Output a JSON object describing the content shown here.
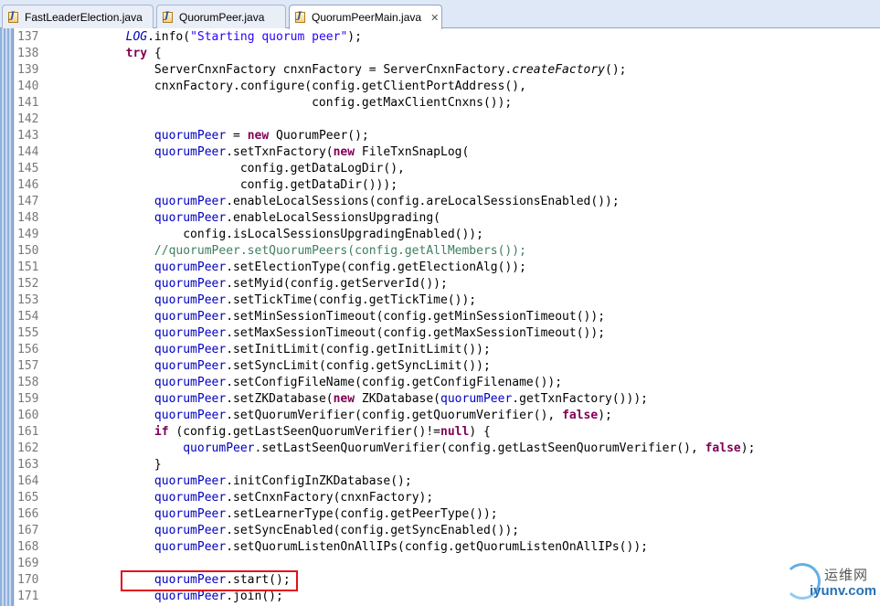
{
  "tabs": [
    {
      "label": "FastLeaderElection.java",
      "active": false
    },
    {
      "label": "QuorumPeer.java",
      "active": false
    },
    {
      "label": "QuorumPeerMain.java",
      "active": true,
      "close": "✕"
    }
  ],
  "colors": {
    "keyword": "#7f0055",
    "field": "#0000c0",
    "string": "#2a00ff",
    "comment": "#3f7f5f",
    "highlight": "#e0121b"
  },
  "lines": [
    {
      "n": "137",
      "tokens": [
        [
          "        ",
          ""
        ],
        [
          "LOG",
          "fld it"
        ],
        [
          ".info(",
          ""
        ],
        [
          "\"Starting quorum peer\"",
          "str"
        ],
        [
          ");",
          ""
        ]
      ]
    },
    {
      "n": "138",
      "tokens": [
        [
          "        ",
          ""
        ],
        [
          "try",
          "kw"
        ],
        [
          " {",
          ""
        ]
      ]
    },
    {
      "n": "139",
      "tokens": [
        [
          "            ServerCnxnFactory cnxnFactory = ServerCnxnFactory.",
          ""
        ],
        [
          "createFactory",
          "it"
        ],
        [
          "();",
          ""
        ]
      ]
    },
    {
      "n": "140",
      "tokens": [
        [
          "            cnxnFactory.configure(config.getClientPortAddress(),",
          ""
        ]
      ]
    },
    {
      "n": "141",
      "tokens": [
        [
          "                                  config.getMaxClientCnxns());",
          ""
        ]
      ]
    },
    {
      "n": "142",
      "tokens": []
    },
    {
      "n": "143",
      "tokens": [
        [
          "            ",
          ""
        ],
        [
          "quorumPeer",
          "fld"
        ],
        [
          " = ",
          ""
        ],
        [
          "new",
          "kw"
        ],
        [
          " QuorumPeer();",
          ""
        ]
      ]
    },
    {
      "n": "144",
      "tokens": [
        [
          "            ",
          ""
        ],
        [
          "quorumPeer",
          "fld"
        ],
        [
          ".setTxnFactory(",
          ""
        ],
        [
          "new",
          "kw"
        ],
        [
          " FileTxnSnapLog(",
          ""
        ]
      ]
    },
    {
      "n": "145",
      "tokens": [
        [
          "                        config.getDataLogDir(),",
          ""
        ]
      ]
    },
    {
      "n": "146",
      "tokens": [
        [
          "                        config.getDataDir()));",
          ""
        ]
      ]
    },
    {
      "n": "147",
      "tokens": [
        [
          "            ",
          ""
        ],
        [
          "quorumPeer",
          "fld"
        ],
        [
          ".enableLocalSessions(config.areLocalSessionsEnabled());",
          ""
        ]
      ]
    },
    {
      "n": "148",
      "tokens": [
        [
          "            ",
          ""
        ],
        [
          "quorumPeer",
          "fld"
        ],
        [
          ".enableLocalSessionsUpgrading(",
          ""
        ]
      ]
    },
    {
      "n": "149",
      "tokens": [
        [
          "                config.isLocalSessionsUpgradingEnabled());",
          ""
        ]
      ]
    },
    {
      "n": "150",
      "tokens": [
        [
          "            ",
          ""
        ],
        [
          "//quorumPeer.setQuorumPeers(config.getAllMembers());",
          "cm"
        ]
      ]
    },
    {
      "n": "151",
      "tokens": [
        [
          "            ",
          ""
        ],
        [
          "quorumPeer",
          "fld"
        ],
        [
          ".setElectionType(config.getElectionAlg());",
          ""
        ]
      ]
    },
    {
      "n": "152",
      "tokens": [
        [
          "            ",
          ""
        ],
        [
          "quorumPeer",
          "fld"
        ],
        [
          ".setMyid(config.getServerId());",
          ""
        ]
      ]
    },
    {
      "n": "153",
      "tokens": [
        [
          "            ",
          ""
        ],
        [
          "quorumPeer",
          "fld"
        ],
        [
          ".setTickTime(config.getTickTime());",
          ""
        ]
      ]
    },
    {
      "n": "154",
      "tokens": [
        [
          "            ",
          ""
        ],
        [
          "quorumPeer",
          "fld"
        ],
        [
          ".setMinSessionTimeout(config.getMinSessionTimeout());",
          ""
        ]
      ]
    },
    {
      "n": "155",
      "tokens": [
        [
          "            ",
          ""
        ],
        [
          "quorumPeer",
          "fld"
        ],
        [
          ".setMaxSessionTimeout(config.getMaxSessionTimeout());",
          ""
        ]
      ]
    },
    {
      "n": "156",
      "tokens": [
        [
          "            ",
          ""
        ],
        [
          "quorumPeer",
          "fld"
        ],
        [
          ".setInitLimit(config.getInitLimit());",
          ""
        ]
      ]
    },
    {
      "n": "157",
      "tokens": [
        [
          "            ",
          ""
        ],
        [
          "quorumPeer",
          "fld"
        ],
        [
          ".setSyncLimit(config.getSyncLimit());",
          ""
        ]
      ]
    },
    {
      "n": "158",
      "tokens": [
        [
          "            ",
          ""
        ],
        [
          "quorumPeer",
          "fld"
        ],
        [
          ".setConfigFileName(config.getConfigFilename());",
          ""
        ]
      ]
    },
    {
      "n": "159",
      "tokens": [
        [
          "            ",
          ""
        ],
        [
          "quorumPeer",
          "fld"
        ],
        [
          ".setZKDatabase(",
          ""
        ],
        [
          "new",
          "kw"
        ],
        [
          " ZKDatabase(",
          ""
        ],
        [
          "quorumPeer",
          "fld"
        ],
        [
          ".getTxnFactory()));",
          ""
        ]
      ]
    },
    {
      "n": "160",
      "tokens": [
        [
          "            ",
          ""
        ],
        [
          "quorumPeer",
          "fld"
        ],
        [
          ".setQuorumVerifier(config.getQuorumVerifier(), ",
          ""
        ],
        [
          "false",
          "kw"
        ],
        [
          ");",
          ""
        ]
      ]
    },
    {
      "n": "161",
      "tokens": [
        [
          "            ",
          ""
        ],
        [
          "if",
          "kw"
        ],
        [
          " (config.getLastSeenQuorumVerifier()!=",
          ""
        ],
        [
          "null",
          "kw"
        ],
        [
          ") {",
          ""
        ]
      ]
    },
    {
      "n": "162",
      "tokens": [
        [
          "                ",
          ""
        ],
        [
          "quorumPeer",
          "fld"
        ],
        [
          ".setLastSeenQuorumVerifier(config.getLastSeenQuorumVerifier(), ",
          ""
        ],
        [
          "false",
          "kw"
        ],
        [
          ");",
          ""
        ]
      ]
    },
    {
      "n": "163",
      "tokens": [
        [
          "            }",
          ""
        ]
      ]
    },
    {
      "n": "164",
      "tokens": [
        [
          "            ",
          ""
        ],
        [
          "quorumPeer",
          "fld"
        ],
        [
          ".initConfigInZKDatabase();",
          ""
        ]
      ]
    },
    {
      "n": "165",
      "tokens": [
        [
          "            ",
          ""
        ],
        [
          "quorumPeer",
          "fld"
        ],
        [
          ".setCnxnFactory(cnxnFactory);",
          ""
        ]
      ]
    },
    {
      "n": "166",
      "tokens": [
        [
          "            ",
          ""
        ],
        [
          "quorumPeer",
          "fld"
        ],
        [
          ".setLearnerType(config.getPeerType());",
          ""
        ]
      ]
    },
    {
      "n": "167",
      "tokens": [
        [
          "            ",
          ""
        ],
        [
          "quorumPeer",
          "fld"
        ],
        [
          ".setSyncEnabled(config.getSyncEnabled());",
          ""
        ]
      ]
    },
    {
      "n": "168",
      "tokens": [
        [
          "            ",
          ""
        ],
        [
          "quorumPeer",
          "fld"
        ],
        [
          ".setQuorumListenOnAllIPs(config.getQuorumListenOnAllIPs());",
          ""
        ]
      ]
    },
    {
      "n": "169",
      "tokens": []
    },
    {
      "n": "170",
      "tokens": [
        [
          "            ",
          ""
        ],
        [
          "quorumPeer",
          "fld"
        ],
        [
          ".start();",
          ""
        ]
      ]
    },
    {
      "n": "171",
      "tokens": [
        [
          "            ",
          ""
        ],
        [
          "quorumPeer",
          "fld"
        ],
        [
          ".join();",
          ""
        ]
      ]
    }
  ],
  "watermark": {
    "cn": "运维网",
    "url": "iyunv.com"
  }
}
